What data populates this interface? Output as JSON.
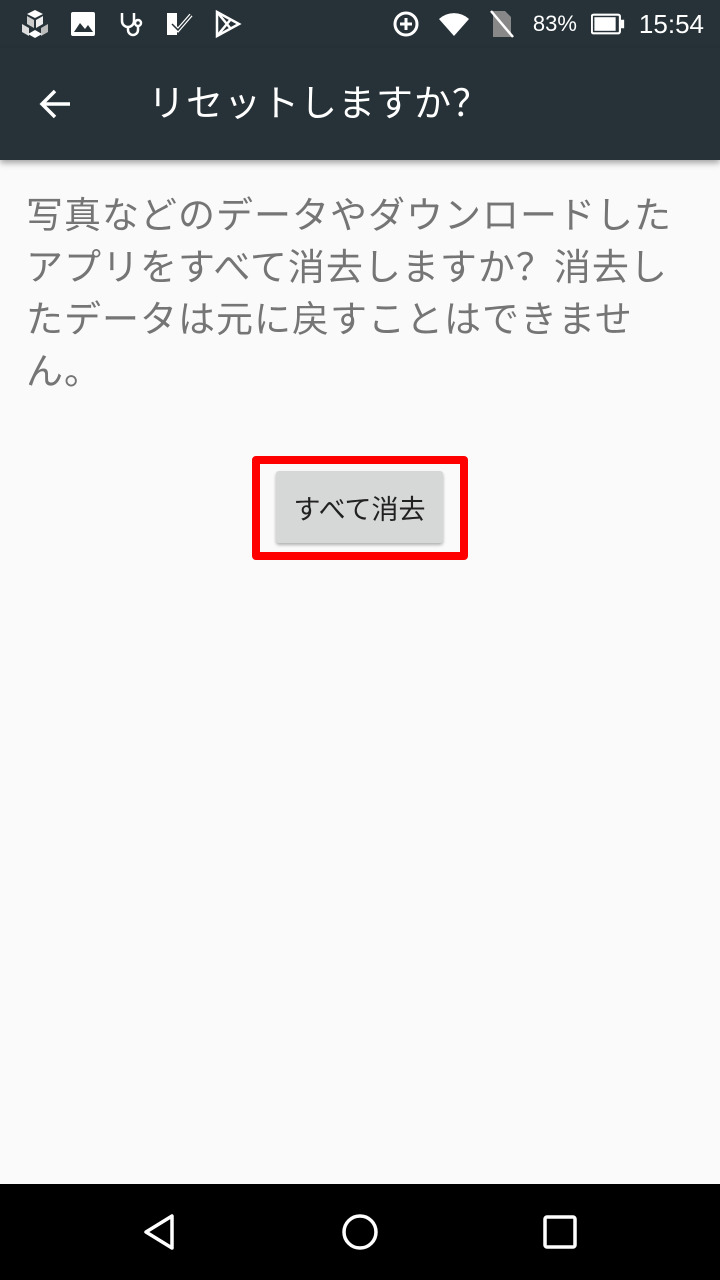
{
  "status_bar": {
    "battery_percent": "83%",
    "time": "15:54",
    "left_icons": [
      "cube-icon",
      "image-icon",
      "stethoscope-icon",
      "check-app-icon",
      "play-store-icon"
    ],
    "right_icons": [
      "data-saver-icon",
      "wifi-icon",
      "no-sim-icon",
      "battery-icon"
    ]
  },
  "app_bar": {
    "title": "リセットしますか？",
    "back_icon": "arrow-back-icon"
  },
  "main": {
    "description": "写真などのデータやダウンロードしたアプリをすべて消去しますか？消去したデータは元に戻すことはできません。",
    "erase_button_label": "すべて消去",
    "highlight_color": "#ff0000"
  },
  "nav_bar": {
    "icons": [
      "back-triangle-icon",
      "home-circle-icon",
      "recents-square-icon"
    ]
  },
  "colors": {
    "app_bar": "#263238",
    "background": "#fafafa",
    "text_secondary": "#757575"
  }
}
